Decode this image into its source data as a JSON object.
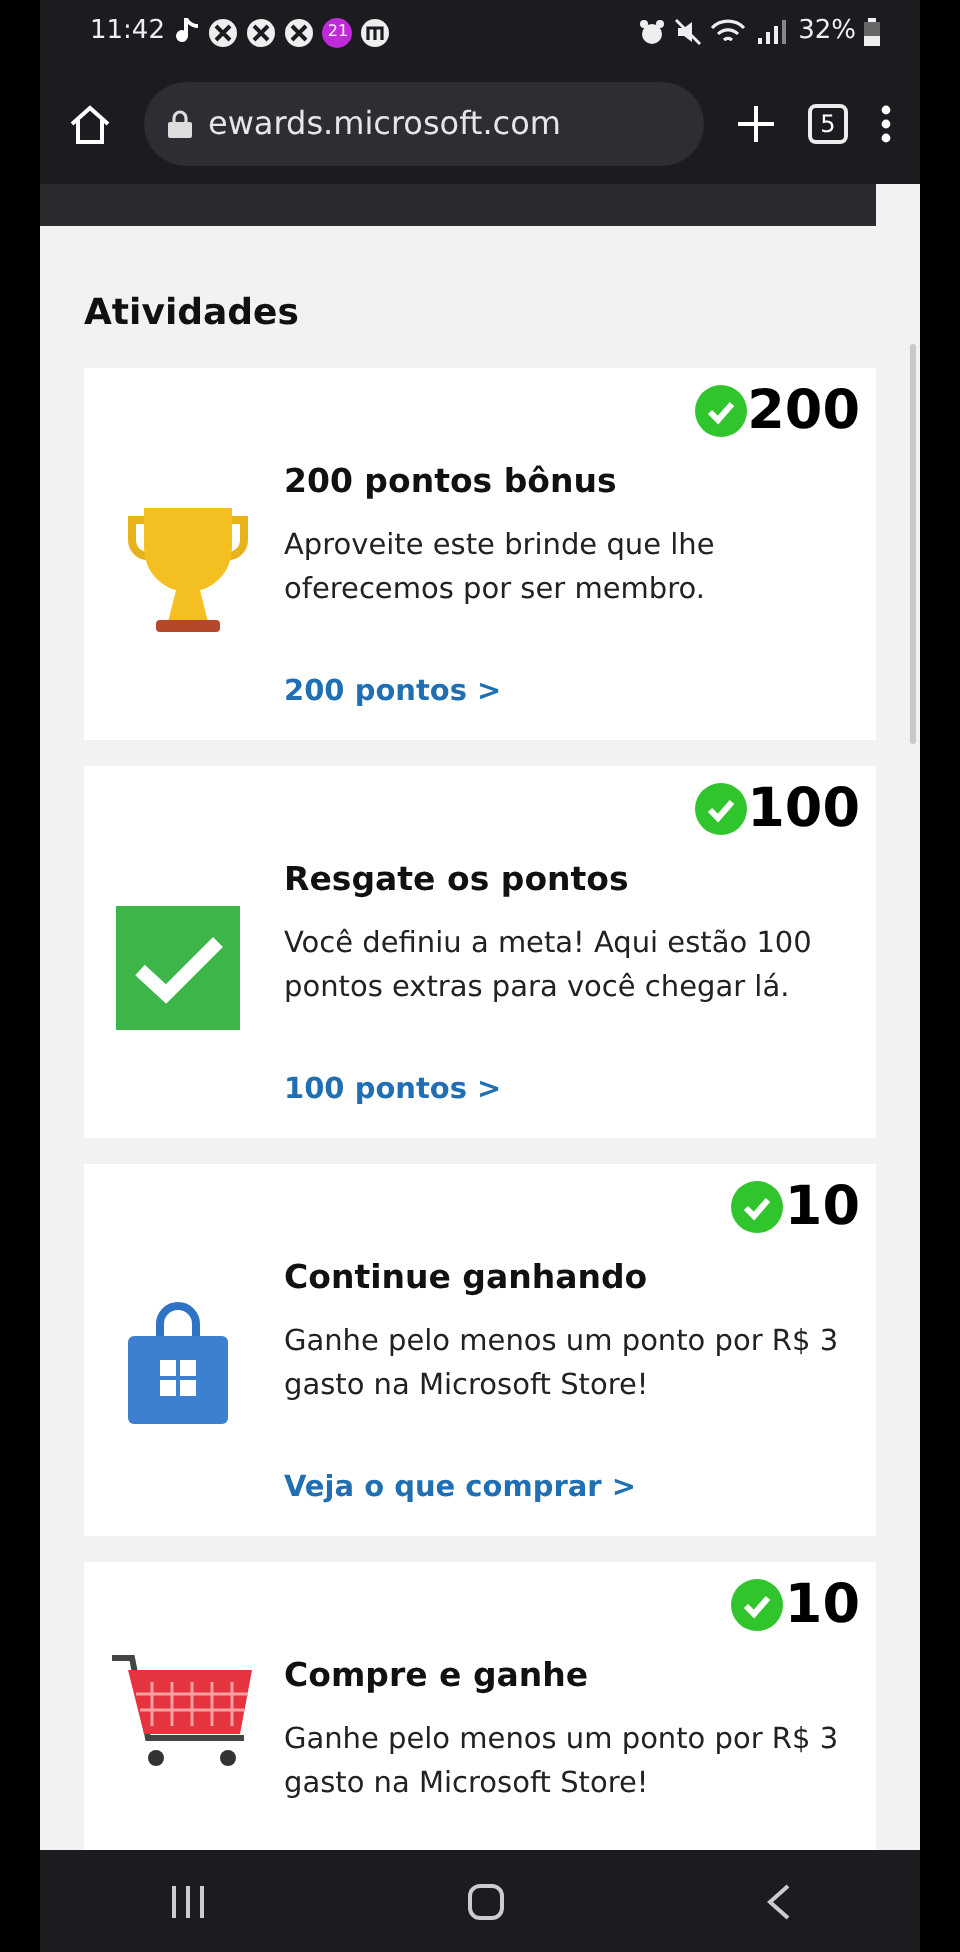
{
  "status_bar": {
    "time": "11:42",
    "notification_badge": "21",
    "battery": "32%"
  },
  "browser": {
    "url": "ewards.microsoft.com",
    "tab_count": "5"
  },
  "section_title": "Atividades",
  "activities": [
    {
      "completed": true,
      "points": "200",
      "title": "200 pontos bônus",
      "description": "Aproveite este brinde que lhe oferecemos por ser membro.",
      "link": "200 pontos >"
    },
    {
      "completed": true,
      "points": "100",
      "title": "Resgate os pontos",
      "description": "Você definiu a meta! Aqui estão 100 pontos extras para você chegar lá.",
      "link": "100 pontos >"
    },
    {
      "completed": true,
      "points": "10",
      "title": "Continue ganhando",
      "description": "Ganhe pelo menos um ponto por R$ 3 gasto na Microsoft Store!",
      "link": "Veja o que comprar >"
    },
    {
      "completed": true,
      "points": "10",
      "title": "Compre e ganhe",
      "description": "Ganhe pelo menos um ponto por R$ 3 gasto na Microsoft Store!"
    }
  ]
}
